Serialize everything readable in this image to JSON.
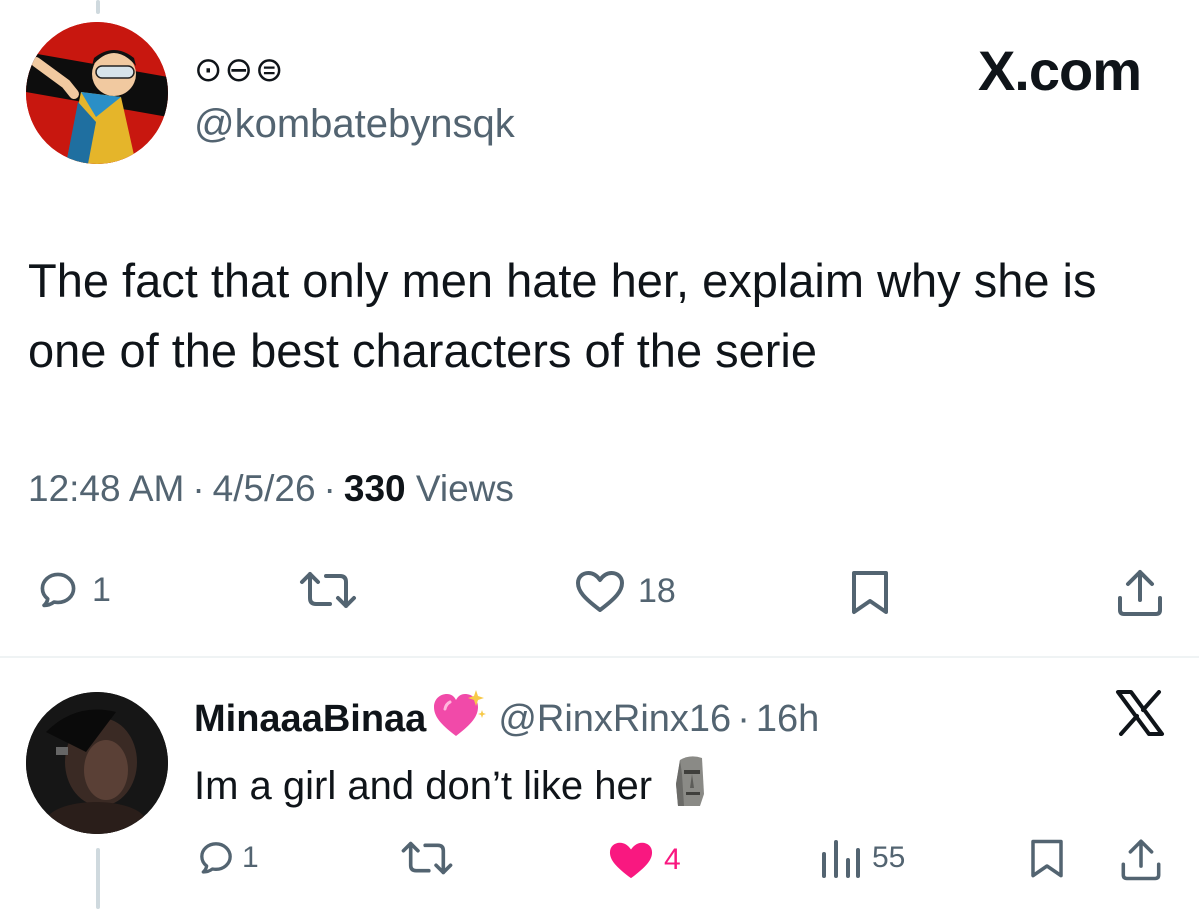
{
  "main_tweet": {
    "name_glyphs": "⊙⊖⊜",
    "handle": "@kombatebynsqk",
    "text": "The fact that only men hate her, explaim why she is one of the best characters of the serie",
    "time": "12:48 AM",
    "date": "4/5/26",
    "views_count": "330",
    "views_label": "Views",
    "separator": "·",
    "actions": {
      "reply_count": "1",
      "like_count": "18"
    }
  },
  "brand": "X.com",
  "reply": {
    "name": "MinaaaBinaa",
    "name_emoji": "sparkling-heart",
    "handle": "@RinxRinx16",
    "separator": "·",
    "time": "16h",
    "text": "Im a girl and don’t like her",
    "text_emoji": "moai",
    "actions": {
      "reply_count": "1",
      "like_count": "4",
      "views_count": "55"
    }
  },
  "colors": {
    "text": "#0f1419",
    "secondary": "#536471",
    "like": "#f91880",
    "divider": "#eff3f4"
  }
}
